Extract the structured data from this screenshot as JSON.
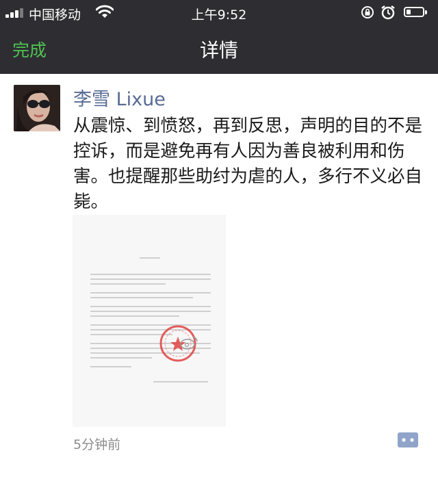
{
  "status_bar": {
    "carrier": "中国移动",
    "time": "上午9:52"
  },
  "nav": {
    "done_label": "完成",
    "title": "详情"
  },
  "post": {
    "author": "李雪 Lixue",
    "text": "从震惊、到愤怒，再到反思，声明的目的不是控诉，而是避免再有人因为善良被利用和伤害。也提醒那些助纣为虐的人，多行不义必自毙。",
    "timestamp": "5分钟前"
  },
  "colors": {
    "bar_background": "#2e2e32",
    "done_green": "#4ec252",
    "author_link": "#576b95",
    "seal_red": "#e0413f"
  },
  "icons": {
    "signal": "signal-bars-icon",
    "wifi": "wifi-icon",
    "rotation_lock": "rotation-lock-icon",
    "alarm": "alarm-icon",
    "battery": "battery-icon",
    "comment": "comment-icon"
  }
}
